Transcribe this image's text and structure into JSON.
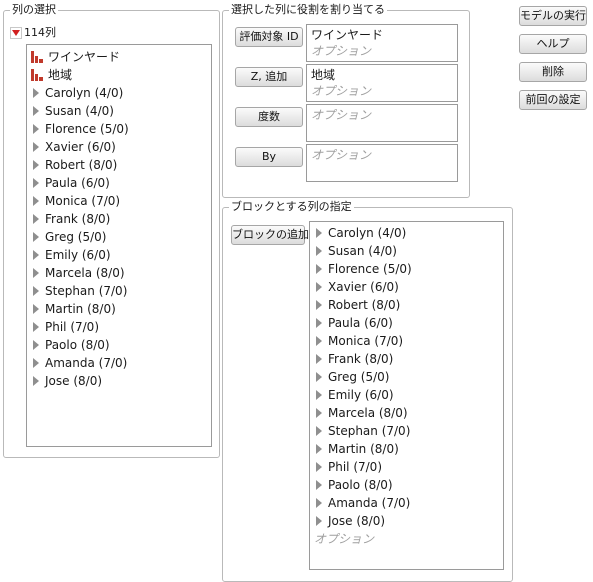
{
  "left_panel": {
    "title": "列の選択",
    "column_count": "114列",
    "columns": [
      {
        "label": "ワインヤード",
        "icon": "nominal-bar-chart-icon"
      },
      {
        "label": "地域",
        "icon": "nominal-bar-chart-icon"
      },
      {
        "label": "Carolyn (4/0)",
        "icon": "expand-triangle-icon"
      },
      {
        "label": "Susan (4/0)",
        "icon": "expand-triangle-icon"
      },
      {
        "label": "Florence (5/0)",
        "icon": "expand-triangle-icon"
      },
      {
        "label": "Xavier (6/0)",
        "icon": "expand-triangle-icon"
      },
      {
        "label": "Robert (8/0)",
        "icon": "expand-triangle-icon"
      },
      {
        "label": "Paula (6/0)",
        "icon": "expand-triangle-icon"
      },
      {
        "label": "Monica (7/0)",
        "icon": "expand-triangle-icon"
      },
      {
        "label": "Frank (8/0)",
        "icon": "expand-triangle-icon"
      },
      {
        "label": "Greg (5/0)",
        "icon": "expand-triangle-icon"
      },
      {
        "label": "Emily (6/0)",
        "icon": "expand-triangle-icon"
      },
      {
        "label": "Marcela (8/0)",
        "icon": "expand-triangle-icon"
      },
      {
        "label": "Stephan (7/0)",
        "icon": "expand-triangle-icon"
      },
      {
        "label": "Martin (8/0)",
        "icon": "expand-triangle-icon"
      },
      {
        "label": "Phil (7/0)",
        "icon": "expand-triangle-icon"
      },
      {
        "label": "Paolo (8/0)",
        "icon": "expand-triangle-icon"
      },
      {
        "label": "Amanda (7/0)",
        "icon": "expand-triangle-icon"
      },
      {
        "label": "Jose (8/0)",
        "icon": "expand-triangle-icon"
      }
    ]
  },
  "roles_panel": {
    "title": "選択した列に役割を割り当てる",
    "roles": [
      {
        "button": "評価対象 ID",
        "value": "ワインヤード",
        "placeholder": "オプション"
      },
      {
        "button": "Z, 追加",
        "value": "地域",
        "placeholder": "オプション"
      },
      {
        "button": "度数",
        "value": "",
        "placeholder": "オプション"
      },
      {
        "button": "By",
        "value": "",
        "placeholder": "オプション"
      }
    ]
  },
  "block_panel": {
    "title": "ブロックとする列の指定",
    "add_button": "ブロックの追加",
    "columns": [
      "Carolyn (4/0)",
      "Susan (4/0)",
      "Florence (5/0)",
      "Xavier (6/0)",
      "Robert (8/0)",
      "Paula (6/0)",
      "Monica (7/0)",
      "Frank (8/0)",
      "Greg (5/0)",
      "Emily (6/0)",
      "Marcela (8/0)",
      "Stephan (7/0)",
      "Martin (8/0)",
      "Phil (7/0)",
      "Paolo (8/0)",
      "Amanda (7/0)",
      "Jose (8/0)"
    ],
    "placeholder": "オプション"
  },
  "actions": {
    "run": "モデルの実行",
    "help": "ヘルプ",
    "remove": "削除",
    "recall": "前回の設定"
  },
  "colors": {
    "nominal_icon": "#c0392b",
    "popup_triangle": "#d11f1f",
    "placeholder_text": "#a0a0a0"
  }
}
